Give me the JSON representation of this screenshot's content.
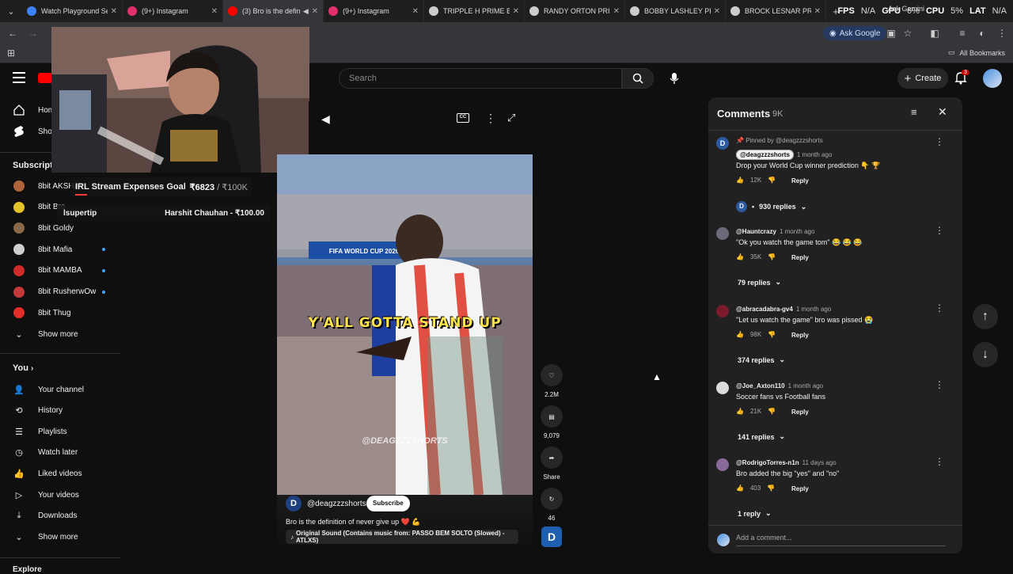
{
  "tabs": [
    {
      "title": "Watch Playground Sea",
      "fav": "#3b82f6",
      "active": false
    },
    {
      "title": "(9+) Instagram",
      "fav": "#e1306c",
      "active": false
    },
    {
      "title": "(3) Bro is the defin",
      "fav": "#ff0000",
      "active": true
    },
    {
      "title": "(9+) Instagram",
      "fav": "#e1306c",
      "active": false
    },
    {
      "title": "TRIPPLE H PRIME BOD",
      "fav": "#cccccc",
      "active": false
    },
    {
      "title": "RANDY ORTON PRIME",
      "fav": "#cccccc",
      "active": false
    },
    {
      "title": "BOBBY LASHLEY PRIM",
      "fav": "#cccccc",
      "active": false
    },
    {
      "title": "BROCK LESNAR PRIM",
      "fav": "#cccccc",
      "active": false
    }
  ],
  "stats": {
    "fps": "FPS",
    "fps_val": "N/A",
    "gpu": "GPU",
    "gpu_val": "6%",
    "cpu": "CPU",
    "cpu_val": "5%",
    "lat": "LAT",
    "lat_val": "N/A",
    "gemini": "Ask Gemini"
  },
  "browser": {
    "ask_google": "Ask Google",
    "all_bookmarks": "All Bookmarks"
  },
  "yt": {
    "search_placeholder": "Search",
    "create": "Create",
    "notif_count": "3"
  },
  "sidebar": {
    "home": "Home",
    "shorts": "Shorts",
    "subs_head": "Subscriptions",
    "channels": [
      {
        "name": "8bit AKSHAY",
        "color": "#b0643c",
        "dot": false
      },
      {
        "name": "8bit Bro",
        "color": "#e6c229",
        "dot": false
      },
      {
        "name": "8bit Goldy",
        "color": "#8a6a4a",
        "dot": false
      },
      {
        "name": "8bit Mafia",
        "color": "#cfcfcf",
        "dot": true
      },
      {
        "name": "8bit MAMBA",
        "color": "#d02a2a",
        "dot": true
      },
      {
        "name": "8bit RusherwOw",
        "color": "#c43a3a",
        "dot": true
      },
      {
        "name": "8bit Thug",
        "color": "#e52d27",
        "dot": false
      }
    ],
    "show_more_1": "Show more",
    "you_head": "You",
    "you_items": [
      "Your channel",
      "History",
      "Playlists",
      "Watch later",
      "Liked videos",
      "Your videos",
      "Downloads"
    ],
    "show_more_2": "Show more",
    "explore": "Explore"
  },
  "stream": {
    "goal_label": "IRL Stream Expenses Goal",
    "goal_amount": "₹6823",
    "goal_total": " / ₹100K",
    "goal_progress": 0.068,
    "tipper": "lsupertip",
    "tip_text": "Harshit Chauhan - ₹100.00"
  },
  "short": {
    "caption": "Y'ALL GOTTA STAND UP",
    "watermark": "@DEAGZZZSHORTS",
    "channel": "@deagzzzshorts",
    "subscribe": "Subscribe",
    "title": "Bro is the definition of never give up ❤️ 💪",
    "sound": "Original Sound (Contains music from: PASSO BEM SOLTO (Slowed) - ATLXS)",
    "likes": "2.2M",
    "comments": "9,079",
    "share": "Share",
    "remix": "46",
    "stadium_sign": "FIFA WORLD CUP 2026"
  },
  "comments": {
    "title": "Comments",
    "count": "9K",
    "add_placeholder": "Add a comment...",
    "list": [
      {
        "pinned": "Pinned by @deagzzzshorts",
        "author": "@deagzzzshorts",
        "time": "1 month ago",
        "text": "Drop your World Cup winner prediction 👇 🏆",
        "likes": "12K",
        "reply": "Reply",
        "replies": "930 replies",
        "ava": "#2c5aa0"
      },
      {
        "author": "@Hauntcrazy",
        "time": "1 month ago",
        "text": "\"Ok you watch the game tom\" 😂 😂 😂",
        "likes": "35K",
        "reply": "Reply",
        "replies": "79 replies",
        "ava": "#6a6a7a"
      },
      {
        "author": "@abracadabra-gv4",
        "time": "1 month ago",
        "text": "\"Let us watch the game\" bro was pissed 😭",
        "likes": "98K",
        "reply": "Reply",
        "replies": "374 replies",
        "ava": "#7a1a2a"
      },
      {
        "author": "@Joe_Axton110",
        "time": "1 month ago",
        "text": "Soccer fans vs Football fans",
        "likes": "21K",
        "reply": "Reply",
        "replies": "141 replies",
        "ava": "#dddddd"
      },
      {
        "author": "@RodrigoTorres-n1n",
        "time": "11 days ago",
        "text": "Bro added the big \"yes\" and \"no\"",
        "likes": "403",
        "reply": "Reply",
        "replies": "1 reply",
        "ava": "#8a6a9a"
      }
    ]
  }
}
